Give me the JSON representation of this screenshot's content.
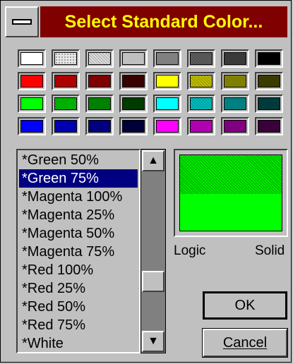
{
  "dialog": {
    "title": "Select Standard Color..."
  },
  "palette": [
    {
      "color": "#ffffff",
      "pattern": "solid"
    },
    {
      "color": "#e8e8e8",
      "pattern": "dotted"
    },
    {
      "color": "#e0e0e0",
      "pattern": "dithered"
    },
    {
      "color": "#c0c0c0",
      "pattern": "solid"
    },
    {
      "color": "#808080",
      "pattern": "solid"
    },
    {
      "color": "#606060",
      "pattern": "dithered"
    },
    {
      "color": "#404040",
      "pattern": "dithered"
    },
    {
      "color": "#000000",
      "pattern": "solid"
    },
    {
      "color": "#ff0000",
      "pattern": "solid"
    },
    {
      "color": "#c00000",
      "pattern": "dithered"
    },
    {
      "color": "#800000",
      "pattern": "solid"
    },
    {
      "color": "#400000",
      "pattern": "dithered"
    },
    {
      "color": "#ffff00",
      "pattern": "solid"
    },
    {
      "color": "#c0c000",
      "pattern": "dithered"
    },
    {
      "color": "#808000",
      "pattern": "solid"
    },
    {
      "color": "#404000",
      "pattern": "dithered"
    },
    {
      "color": "#00ff00",
      "pattern": "solid"
    },
    {
      "color": "#00c000",
      "pattern": "dithered"
    },
    {
      "color": "#008000",
      "pattern": "solid"
    },
    {
      "color": "#004000",
      "pattern": "dithered"
    },
    {
      "color": "#00ffff",
      "pattern": "solid"
    },
    {
      "color": "#00c0c0",
      "pattern": "dithered"
    },
    {
      "color": "#008080",
      "pattern": "solid"
    },
    {
      "color": "#004040",
      "pattern": "dithered"
    },
    {
      "color": "#0000ff",
      "pattern": "solid"
    },
    {
      "color": "#0000c0",
      "pattern": "dithered"
    },
    {
      "color": "#000080",
      "pattern": "solid"
    },
    {
      "color": "#000040",
      "pattern": "dithered"
    },
    {
      "color": "#ff00ff",
      "pattern": "solid"
    },
    {
      "color": "#c000c0",
      "pattern": "dithered"
    },
    {
      "color": "#800080",
      "pattern": "solid"
    },
    {
      "color": "#400040",
      "pattern": "dithered"
    }
  ],
  "color_list": {
    "items": [
      "*Green 50%",
      "*Green 75%",
      "*Magenta 100%",
      "*Magenta 25%",
      "*Magenta 50%",
      "*Magenta 75%",
      "*Red 100%",
      "*Red 25%",
      "*Red 50%",
      "*Red 75%",
      "*White"
    ],
    "selected_index": 1,
    "scroll_position": 0.72
  },
  "preview": {
    "logic_label": "Logic",
    "solid_label": "Solid",
    "logic_color": "#00c000",
    "solid_color": "#00ff00"
  },
  "buttons": {
    "ok_label": "OK",
    "cancel_label": "Cancel"
  },
  "icons": {
    "scroll_up": "up-arrow-icon",
    "scroll_down": "down-arrow-icon",
    "system_menu": "system-menu-icon"
  },
  "colors": {
    "title_bg": "#800000",
    "title_text": "#ffff00",
    "selection_bg": "#000080"
  }
}
